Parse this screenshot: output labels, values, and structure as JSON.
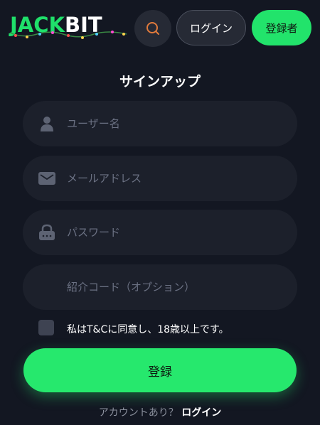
{
  "header": {
    "logo_left": "JACK",
    "logo_right": "BIT",
    "login_label": "ログイン",
    "register_label": "登録者"
  },
  "form": {
    "title": "サインアップ",
    "username_placeholder": "ユーザー名",
    "email_placeholder": "メールアドレス",
    "password_placeholder": "パスワード",
    "referral_placeholder": "紹介コード（オプション）",
    "agree_text": "私はT&Cに同意し、18歳以上です。",
    "submit_label": "登録"
  },
  "footer": {
    "question": "アカウントあり？",
    "login_link": "ログイン"
  },
  "colors": {
    "background": "#131722",
    "accent_green": "#26e86d",
    "field_bg": "#1c202b"
  },
  "icons": [
    "search-icon",
    "user-icon",
    "mail-icon",
    "lock-icon"
  ]
}
